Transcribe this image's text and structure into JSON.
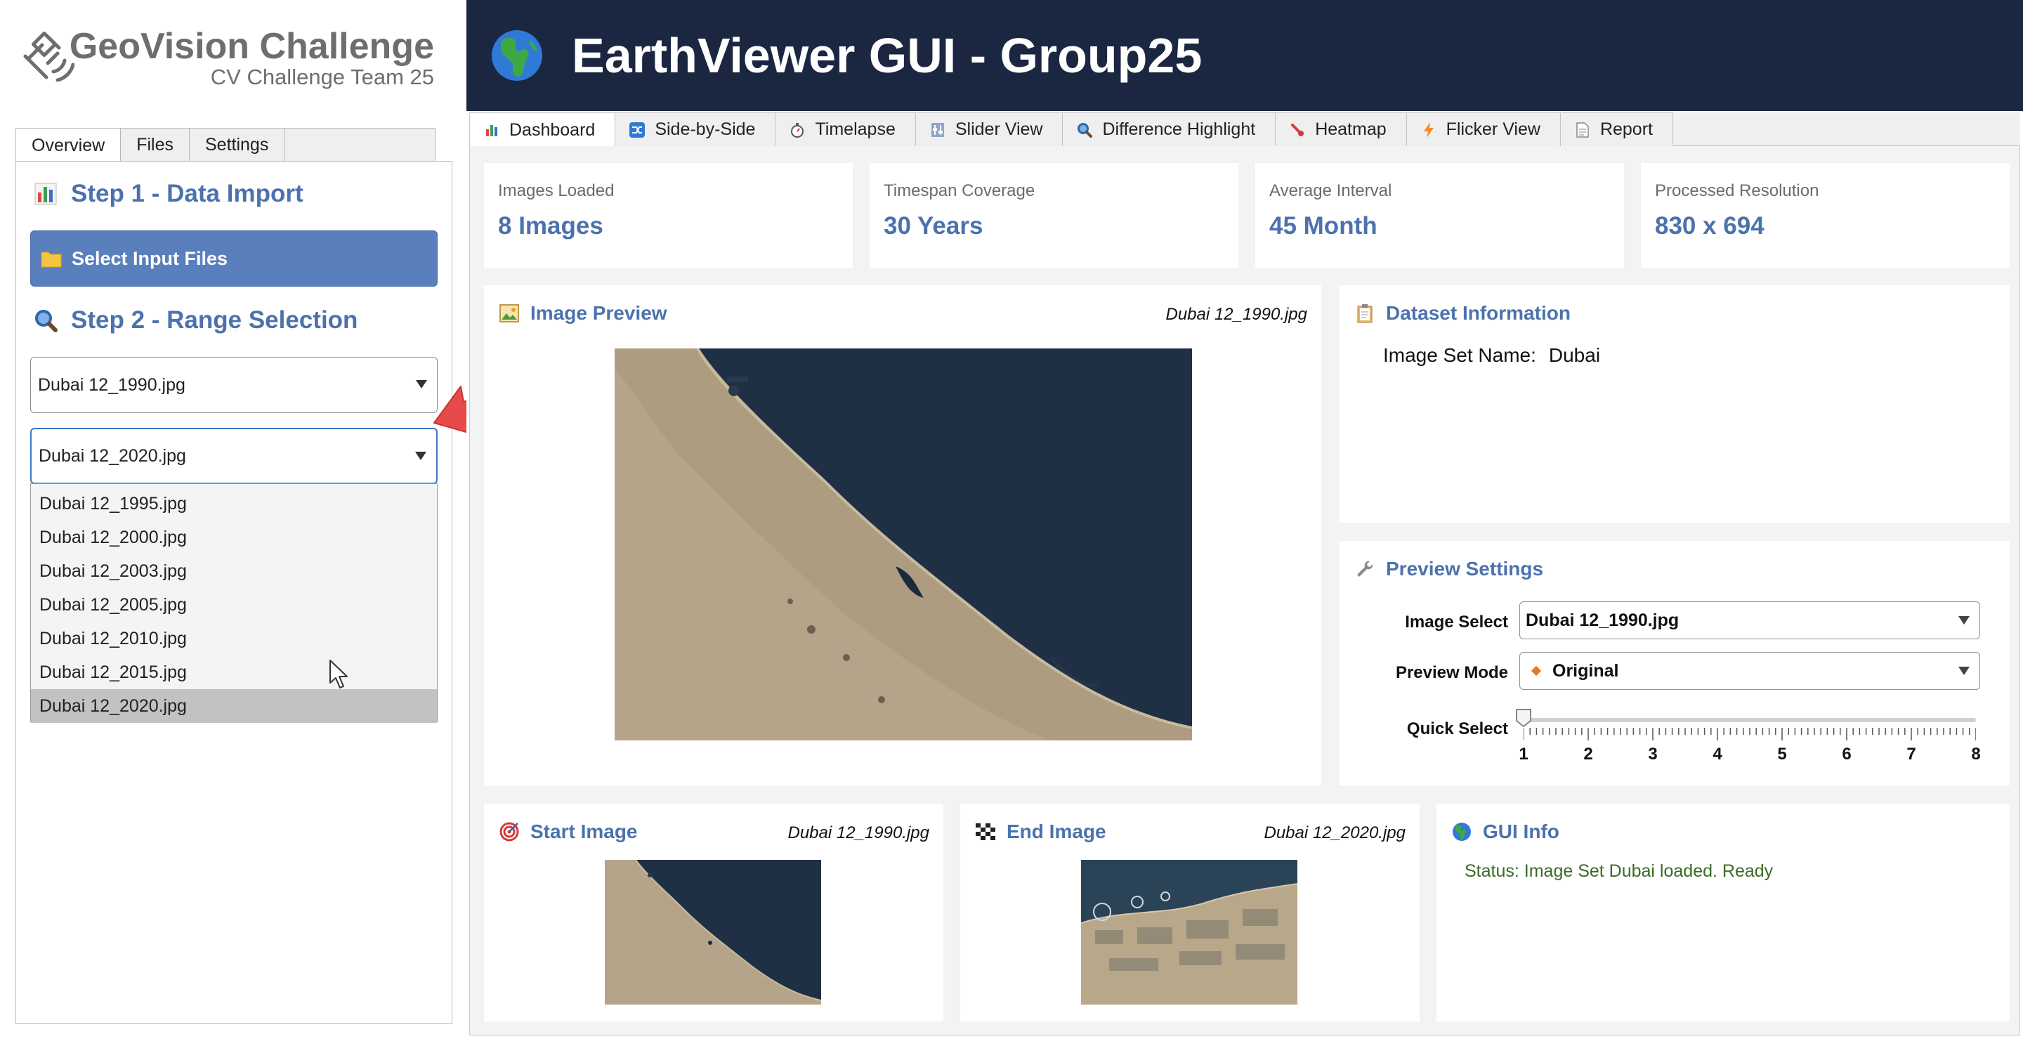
{
  "logo": {
    "title": "GeoVision Challenge",
    "subtitle": "CV Challenge Team 25"
  },
  "left_tabs": [
    {
      "label": "Overview",
      "active": true
    },
    {
      "label": "Files",
      "active": false
    },
    {
      "label": "Settings",
      "active": false
    }
  ],
  "step1": {
    "title": "Step 1 - Data Import",
    "icon": "bar-chart-icon"
  },
  "select_files_button": {
    "label": "Select Input Files",
    "icon": "folder-icon"
  },
  "step2": {
    "title": "Step 2 - Range Selection",
    "icon": "magnifier-icon"
  },
  "range": {
    "start_value": "Dubai 12_1990.jpg",
    "end_value": "Dubai 12_2020.jpg",
    "dropdown_options": [
      "Dubai 12_1995.jpg",
      "Dubai 12_2000.jpg",
      "Dubai 12_2003.jpg",
      "Dubai 12_2005.jpg",
      "Dubai 12_2010.jpg",
      "Dubai 12_2015.jpg",
      "Dubai 12_2020.jpg"
    ],
    "highlighted_option": "Dubai 12_2020.jpg"
  },
  "header": {
    "title": "EarthViewer GUI - Group25",
    "icon": "globe-icon"
  },
  "main_tabs": [
    {
      "label": "Dashboard",
      "icon": "bar-chart-icon",
      "active": true
    },
    {
      "label": "Side-by-Side",
      "icon": "shuffle-icon",
      "active": false
    },
    {
      "label": "Timelapse",
      "icon": "stopwatch-icon",
      "active": false
    },
    {
      "label": "Slider View",
      "icon": "slider-icon",
      "active": false
    },
    {
      "label": "Difference Highlight",
      "icon": "magnifier-icon",
      "active": false
    },
    {
      "label": "Heatmap",
      "icon": "thermometer-icon",
      "active": false
    },
    {
      "label": "Flicker View",
      "icon": "lightning-icon",
      "active": false
    },
    {
      "label": "Report",
      "icon": "document-icon",
      "active": false
    }
  ],
  "stats": [
    {
      "label": "Images Loaded",
      "value": "8 Images"
    },
    {
      "label": "Timespan Coverage",
      "value": "30 Years"
    },
    {
      "label": "Average Interval",
      "value": "45 Month"
    },
    {
      "label": "Processed Resolution",
      "value": "830 x 694"
    }
  ],
  "image_preview": {
    "title": "Image Preview",
    "filename": "Dubai 12_1990.jpg",
    "icon": "picture-icon"
  },
  "dataset_info": {
    "title": "Dataset Information",
    "icon": "clipboard-icon",
    "name_label": "Image Set Name:",
    "name_value": "Dubai"
  },
  "preview_settings": {
    "title": "Preview Settings",
    "icon": "wrench-icon",
    "image_select_label": "Image Select",
    "image_select_value": "Dubai 12_1990.jpg",
    "preview_mode_label": "Preview Mode",
    "preview_mode_value": "Original",
    "quick_select_label": "Quick Select",
    "quick_select_ticks": [
      "1",
      "2",
      "3",
      "4",
      "5",
      "6",
      "7",
      "8"
    ],
    "quick_select_value": 1
  },
  "start_image": {
    "title": "Start Image",
    "filename": "Dubai 12_1990.jpg",
    "icon": "target-icon"
  },
  "end_image": {
    "title": "End Image",
    "filename": "Dubai 12_2020.jpg",
    "icon": "checkered-flag-icon"
  },
  "gui_info": {
    "title": "GUI Info",
    "icon": "globe-icon",
    "status": "Status: Image Set Dubai loaded. Ready"
  },
  "colors": {
    "accent": "#4c72ad",
    "header_bg": "#1b2641",
    "button_bg": "#5a7fbd",
    "status_green": "#3c6b24",
    "pointer_red": "#e84a4a"
  }
}
